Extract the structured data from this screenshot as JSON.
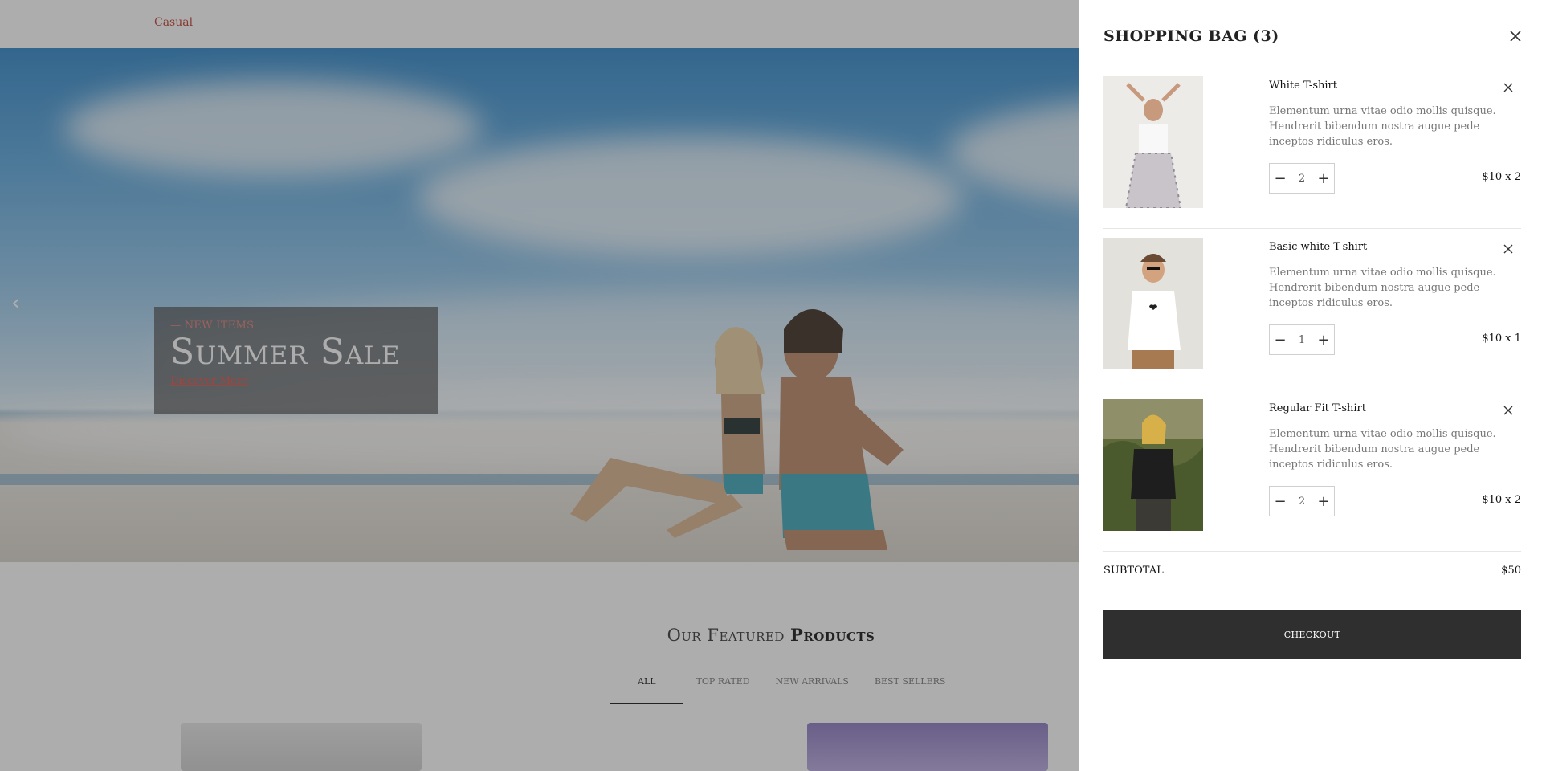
{
  "header": {
    "brand": "Casual"
  },
  "hero": {
    "tag": "— NEW ITEMS",
    "title": "Summer Sale",
    "link": "Discover More",
    "prev_icon": "chevron-left-icon"
  },
  "featured": {
    "title_light": "Our Featured",
    "title_bold": "Products",
    "filters": [
      "ALL",
      "TOP RATED",
      "NEW ARRIVALS",
      "BEST SELLERS"
    ],
    "active_filter": "ALL"
  },
  "cart": {
    "title": "SHOPPING BAG (3)",
    "close_icon": "close-icon",
    "items": [
      {
        "name": "White T-shirt",
        "description": "Elementum urna vitae odio mollis quisque. Hendrerit bibendum nostra augue pede inceptos ridiculus eros.",
        "quantity": "2",
        "price": "$10 x 2"
      },
      {
        "name": "Basic white T-shirt",
        "description": "Elementum urna vitae odio mollis quisque. Hendrerit bibendum nostra augue pede inceptos ridiculus eros.",
        "quantity": "1",
        "price": "$10 x 1"
      },
      {
        "name": "Regular Fit T-shirt",
        "description": "Elementum urna vitae odio mollis quisque. Hendrerit bibendum nostra augue pede inceptos ridiculus eros.",
        "quantity": "2",
        "price": "$10 x 2"
      }
    ],
    "subtotal_label": "SUBTOTAL",
    "subtotal_value": "$50",
    "checkout_label": "CHECKOUT"
  },
  "colors": {
    "brand": "#c0392b",
    "accent_link": "#e84a3e",
    "checkout_bg": "#2f2f2f",
    "overlay": "rgba(60,60,60,0.42)"
  }
}
